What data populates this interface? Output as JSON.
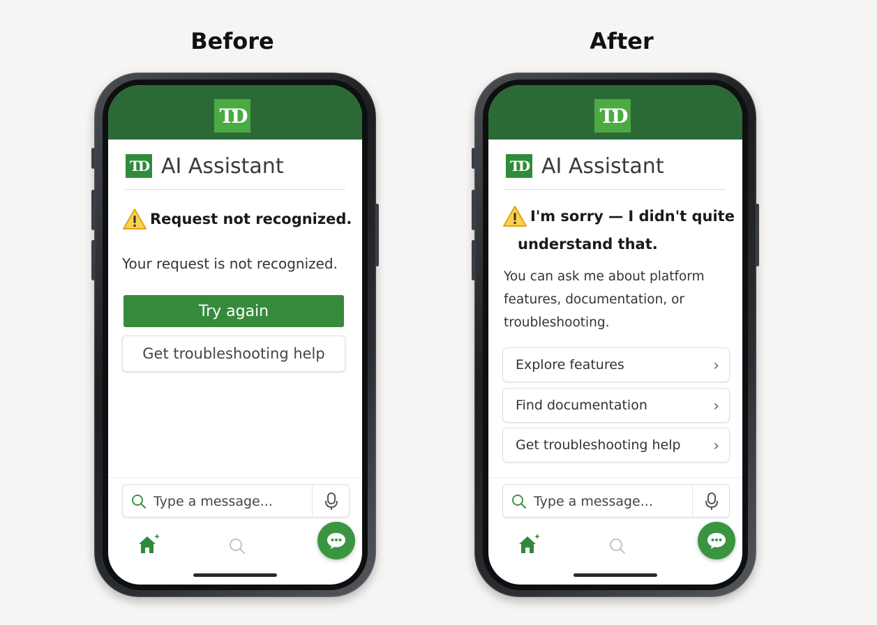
{
  "columns": {
    "before_title": "Before",
    "after_title": "After"
  },
  "brand": {
    "logo_text": "TD",
    "app_title": "AI Assistant",
    "header_color": "#2b6a37",
    "accent_color": "#358a3b"
  },
  "before": {
    "heading": "Request not recognized.",
    "message": "Your request is not recognized.",
    "primary_button": "Try again",
    "secondary_button": "Get troubleshooting help",
    "input_placeholder": "Type a message..."
  },
  "after": {
    "heading_line1": "I'm sorry — I didn't quite",
    "heading_line2": "understand that.",
    "message_line1": "You can ask me about platform",
    "message_line2": "features, documentation, or",
    "message_line3": "troubleshooting.",
    "options": [
      {
        "label": "Explore features"
      },
      {
        "label": "Find documentation"
      },
      {
        "label": "Get troubleshooting help"
      }
    ],
    "chevron": "›",
    "input_placeholder": "Type a message..."
  },
  "icons": {
    "warning": "warning-triangle-icon",
    "search": "search-icon",
    "mic": "microphone-icon",
    "home": "home-sparkle-icon",
    "chat": "chat-bubble-icon"
  }
}
